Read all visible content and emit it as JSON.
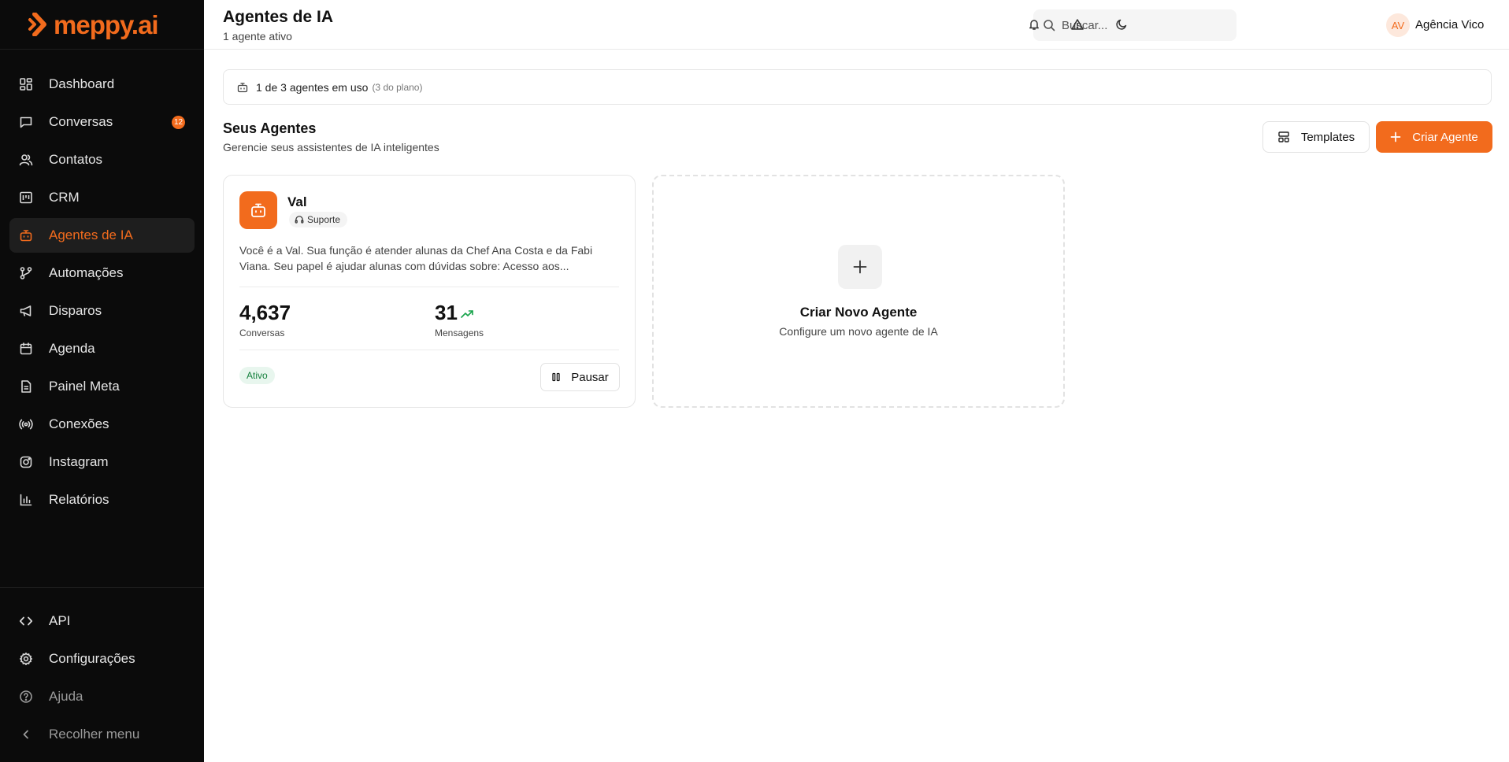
{
  "brand": {
    "name": "meppy.ai",
    "accent": "#f26b1d"
  },
  "sidebar": {
    "items": [
      {
        "label": "Dashboard",
        "icon": "dashboard-icon"
      },
      {
        "label": "Conversas",
        "icon": "chat-icon",
        "badge": "12"
      },
      {
        "label": "Contatos",
        "icon": "users-icon"
      },
      {
        "label": "CRM",
        "icon": "kanban-icon"
      },
      {
        "label": "Agentes de IA",
        "icon": "bot-icon",
        "active": true
      },
      {
        "label": "Automações",
        "icon": "workflow-icon"
      },
      {
        "label": "Disparos",
        "icon": "megaphone-icon"
      },
      {
        "label": "Agenda",
        "icon": "calendar-icon"
      },
      {
        "label": "Painel Meta",
        "icon": "document-icon"
      },
      {
        "label": "Conexões",
        "icon": "radio-icon"
      },
      {
        "label": "Instagram",
        "icon": "instagram-icon"
      },
      {
        "label": "Relatórios",
        "icon": "bar-chart-icon"
      }
    ],
    "bottom": [
      {
        "label": "API",
        "icon": "code-icon"
      },
      {
        "label": "Configurações",
        "icon": "gear-icon"
      },
      {
        "label": "Ajuda",
        "icon": "help-icon"
      },
      {
        "label": "Recolher menu",
        "icon": "chevron-left-icon"
      }
    ]
  },
  "header": {
    "title": "Agentes de IA",
    "subtitle": "1 agente ativo",
    "search_placeholder": "Buscar...",
    "user": {
      "initials": "AV",
      "name": "Agência Vico"
    }
  },
  "usage": {
    "text": "1 de 3 agentes em uso",
    "plan": "(3 do plano)"
  },
  "section": {
    "title": "Seus Agentes",
    "subtitle": "Gerencie seus assistentes de IA inteligentes",
    "templates_label": "Templates",
    "create_label": "Criar Agente"
  },
  "agent": {
    "name": "Val",
    "tag": "Suporte",
    "description": "Você é a Val. Sua função é atender alunas da Chef Ana Costa e da Fabi Viana. Seu papel é ajudar alunas com dúvidas sobre: Acesso aos...",
    "conversations": "4,637",
    "conversations_label": "Conversas",
    "messages": "31",
    "messages_label": "Mensagens",
    "status": "Ativo",
    "pause_label": "Pausar"
  },
  "new_agent": {
    "title": "Criar Novo Agente",
    "subtitle": "Configure um novo agente de IA"
  }
}
